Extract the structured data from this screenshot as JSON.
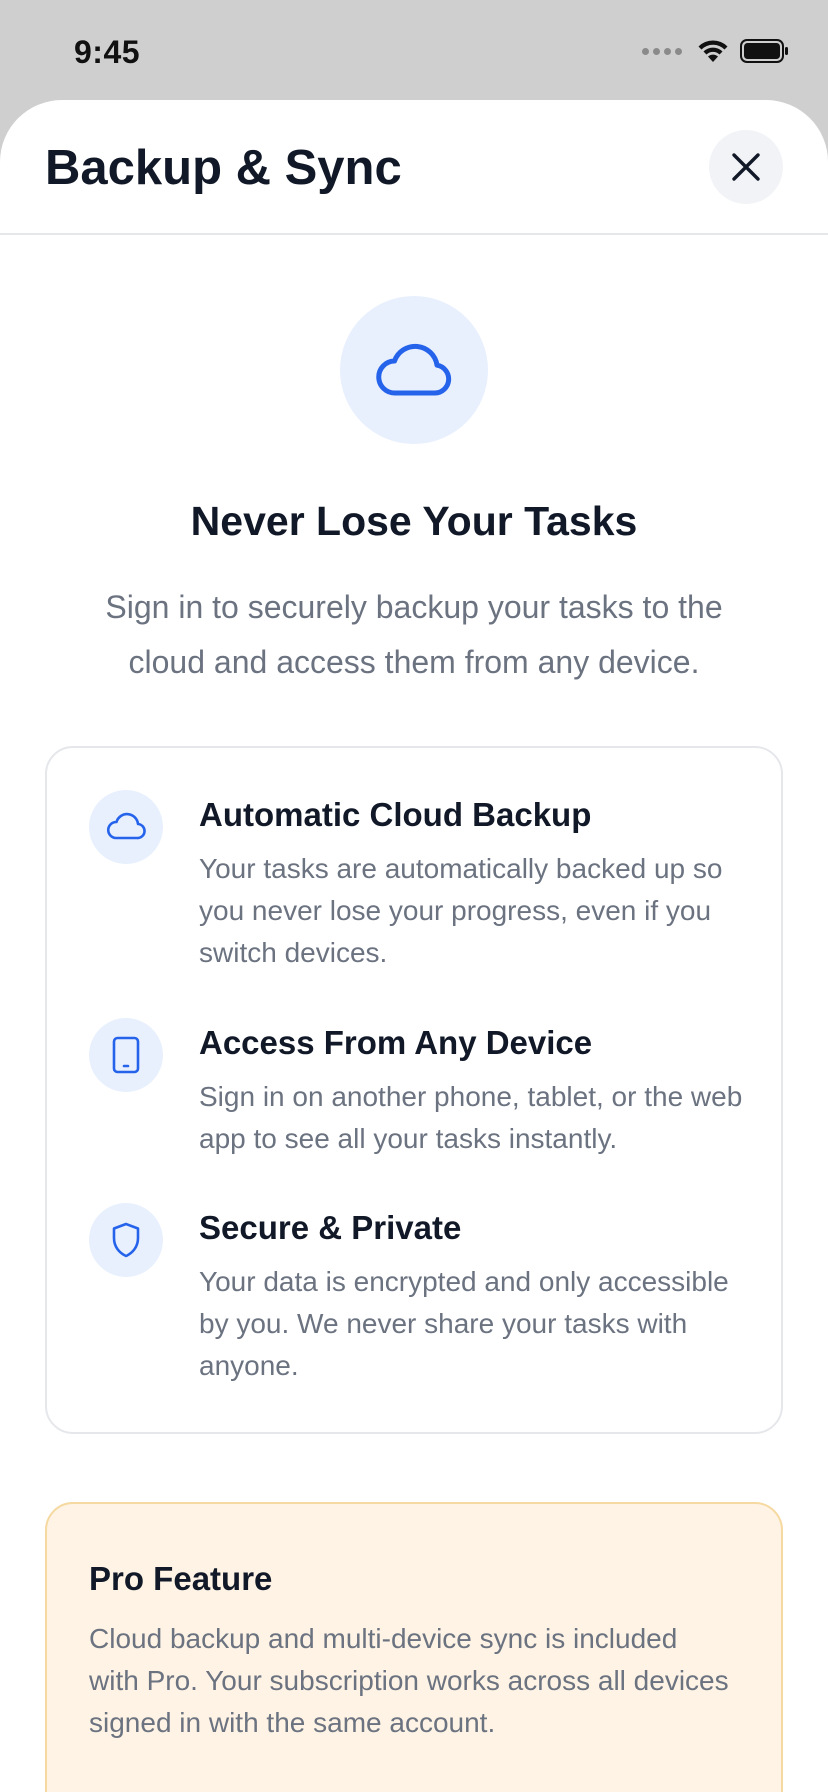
{
  "status_bar": {
    "time": "9:45"
  },
  "sheet": {
    "title": "Backup & Sync",
    "close_icon": "close-icon"
  },
  "hero": {
    "icon": "cloud-icon",
    "title": "Never Lose Your Tasks",
    "subtitle": "Sign in to securely backup your tasks to the cloud and access them from any device."
  },
  "features": [
    {
      "icon": "cloud-icon",
      "title": "Automatic Cloud Backup",
      "description": "Your tasks are automatically backed up so you never lose your progress, even if you switch devices."
    },
    {
      "icon": "tablet-icon",
      "title": "Access From Any Device",
      "description": "Sign in on another phone, tablet, or the web app to see all your tasks instantly."
    },
    {
      "icon": "shield-icon",
      "title": "Secure & Private",
      "description": "Your data is encrypted and only accessible by you. We never share your tasks with anyone."
    }
  ],
  "pro_card": {
    "title": "Pro Feature",
    "description": "Cloud backup and multi-device sync is included with Pro. Your subscription works across all devices signed in with the same account."
  },
  "colors": {
    "accent": "#2563eb",
    "accent_soft": "#e8f0fe",
    "pro_background": "#fef3e4",
    "pro_border": "#f5d9a0",
    "text_primary": "#111827",
    "text_secondary": "#6b7280"
  }
}
